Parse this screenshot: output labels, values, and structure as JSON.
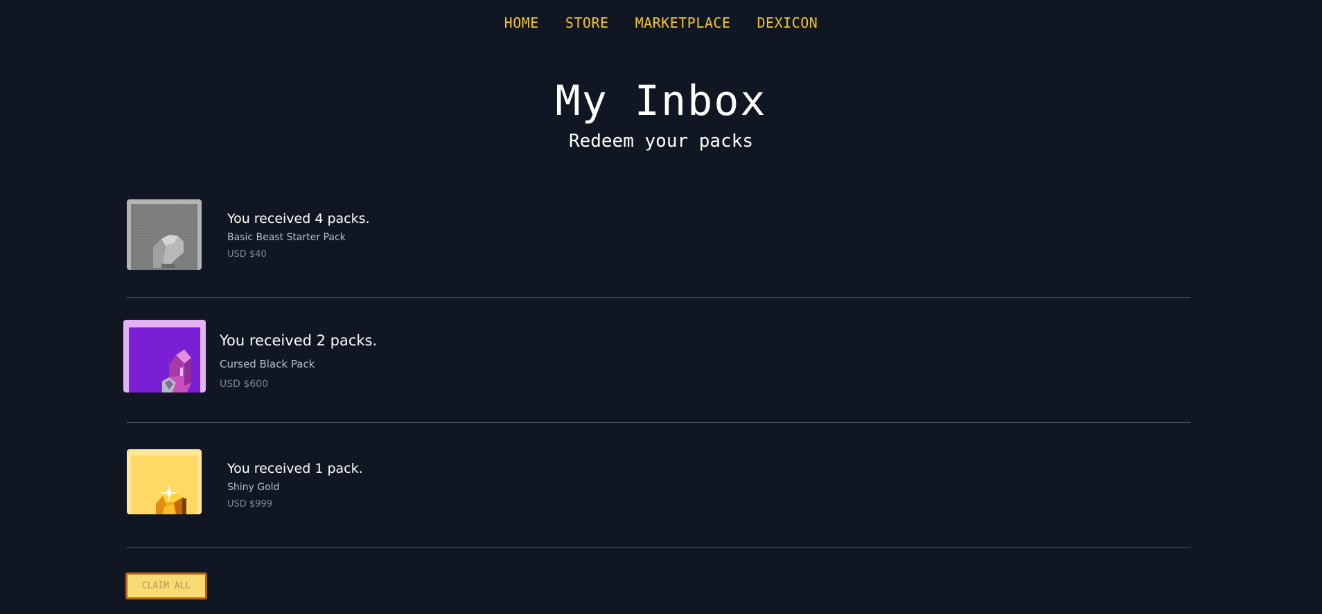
{
  "nav": {
    "items": [
      {
        "label": "HOME"
      },
      {
        "label": "STORE"
      },
      {
        "label": "MARKETPLACE"
      },
      {
        "label": "DEXICON"
      }
    ]
  },
  "header": {
    "title": "My Inbox",
    "subtitle": "Redeem your packs"
  },
  "inbox": {
    "items": [
      {
        "title": "You received 4 packs.",
        "name": "Basic Beast Starter Pack",
        "price": "USD $40",
        "icon": "rock-pack-icon",
        "color": "#8a8a8a"
      },
      {
        "title": "You received 2 packs.",
        "name": "Cursed Black Pack",
        "price": "USD $600",
        "icon": "crystal-pack-icon",
        "color": "#7a1fd6"
      },
      {
        "title": "You received 1 pack.",
        "name": "Shiny Gold",
        "price": "USD $999",
        "icon": "gold-gem-pack-icon",
        "color": "#ffd966"
      }
    ]
  },
  "actions": {
    "claim_all_label": "CLAIM ALL"
  },
  "colors": {
    "background": "#111722",
    "nav_accent": "#f3c526",
    "divider": "#4d5462"
  }
}
